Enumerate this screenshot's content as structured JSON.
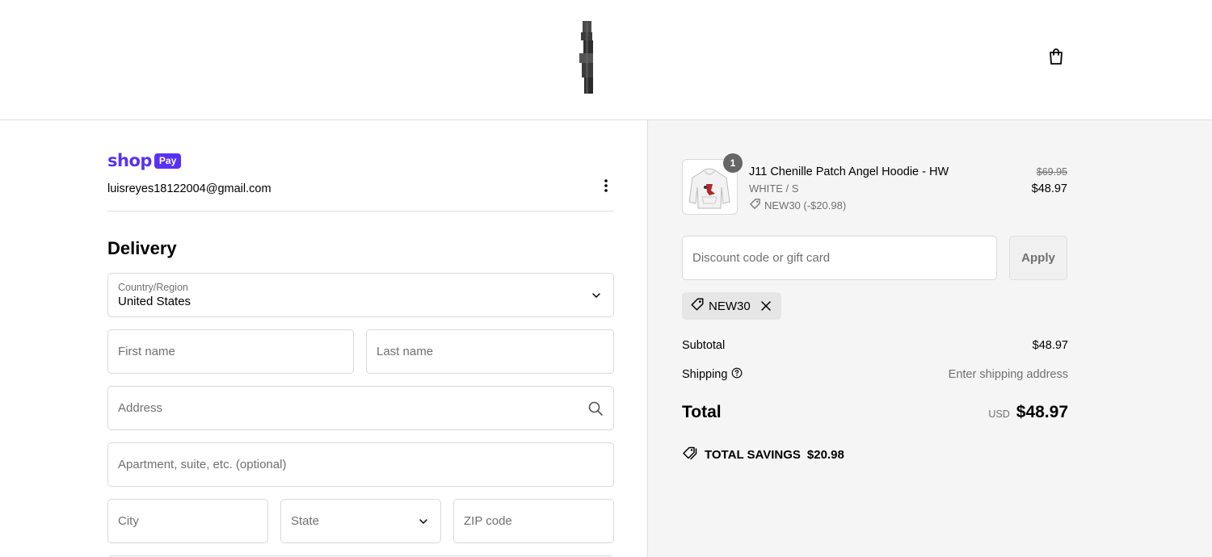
{
  "header": {
    "logo_icon": "brand-logo",
    "cart_icon": "shopping-bag-icon"
  },
  "account": {
    "shop_word": "shop",
    "pay_word": "Pay",
    "email": "luisreyes18122004@gmail.com"
  },
  "delivery": {
    "title": "Delivery",
    "country_label": "Country/Region",
    "country_value": "United States",
    "first_name_placeholder": "First name",
    "last_name_placeholder": "Last name",
    "address_placeholder": "Address",
    "apartment_placeholder": "Apartment, suite, etc. (optional)",
    "city_placeholder": "City",
    "state_label": "State",
    "zip_placeholder": "ZIP code"
  },
  "summary": {
    "item": {
      "quantity": "1",
      "name": "J11 Chenille Patch Angel Hoodie - HW",
      "variant": "WHITE / S",
      "discount": "NEW30 (-$20.98)",
      "original_price": "$69.95",
      "price": "$48.97"
    },
    "discount_placeholder": "Discount code or gift card",
    "apply_label": "Apply",
    "applied_code": "NEW30",
    "subtotal_label": "Subtotal",
    "subtotal_value": "$48.97",
    "shipping_label": "Shipping",
    "shipping_value": "Enter shipping address",
    "total_label": "Total",
    "currency": "USD",
    "total_value": "$48.97",
    "savings_label": "TOTAL SAVINGS",
    "savings_value": "$20.98"
  },
  "colors": {
    "shop_pay_purple": "#5a31f4",
    "summary_background": "#f5f5f5"
  }
}
